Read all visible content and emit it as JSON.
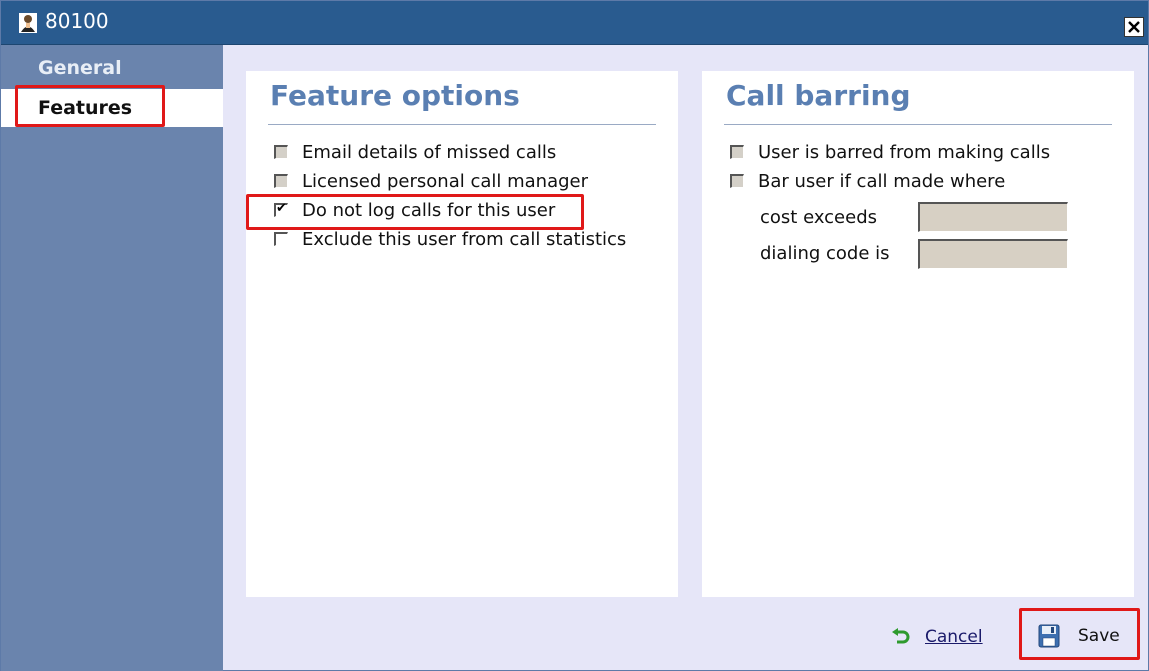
{
  "window": {
    "title": "80100",
    "title_icon": "user-icon",
    "close_icon": "close-icon"
  },
  "sidebar": {
    "items": [
      {
        "label": "General",
        "selected": false
      },
      {
        "label": "Features",
        "selected": true
      }
    ]
  },
  "feature_options": {
    "title": "Feature options",
    "options": [
      {
        "label": "Email details of missed calls",
        "checked": false,
        "enabled": false
      },
      {
        "label": "Licensed personal call manager",
        "checked": false,
        "enabled": false
      },
      {
        "label": "Do not log calls for this user",
        "checked": true,
        "enabled": true
      },
      {
        "label": "Exclude this user from call statistics",
        "checked": false,
        "enabled": true
      }
    ]
  },
  "call_barring": {
    "title": "Call barring",
    "options": [
      {
        "label": "User is barred from making calls",
        "checked": false,
        "enabled": false
      },
      {
        "label": "Bar user if call made where",
        "checked": false,
        "enabled": false
      }
    ],
    "fields": [
      {
        "label": "cost exceeds",
        "value": ""
      },
      {
        "label": "dialing code is",
        "value": ""
      }
    ]
  },
  "footer": {
    "cancel_label": "Cancel",
    "cancel_icon": "undo-arrow-icon",
    "save_label": "Save",
    "save_icon": "floppy-disk-icon"
  },
  "colors": {
    "titlebar": "#295b8f",
    "sidebar": "#6a84ad",
    "panel_title": "#5a7fb2",
    "highlight": "#e01818"
  }
}
